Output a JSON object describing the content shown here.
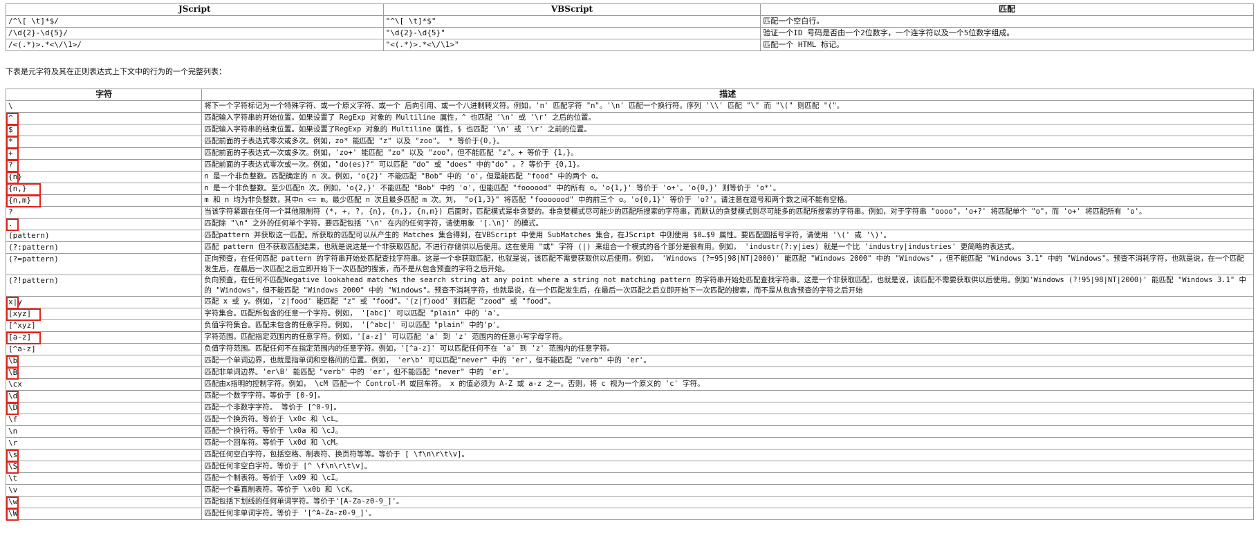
{
  "top_table": {
    "headers": [
      "JScript",
      "VBScript",
      "匹配"
    ],
    "rows": [
      [
        "/^\\[ \\t]*$/",
        "\"^\\[ \\t]*$\"",
        "匹配一个空白行。"
      ],
      [
        "/\\d{2}-\\d{5}/",
        "\"\\d{2}-\\d{5}\"",
        "验证一个ID 号码是否由一个2位数字，一个连字符以及一个5位数字组成。"
      ],
      [
        "/<(.*)>.*<\\/\\1>/",
        "\"<(.*)>.*<\\/\\1>\"",
        "匹配一个 HTML 标记。"
      ]
    ]
  },
  "intro_text": "下表是元字符及其在正则表达式上下文中的行为的一个完整列表：",
  "meta_table": {
    "headers": [
      "字符",
      "描述"
    ],
    "rows": [
      [
        "\\",
        "将下一个字符标记为一个特殊字符、或一个原义字符、或一个 后向引用、或一个八进制转义符。例如，'n' 匹配字符 \"n\"。'\\n' 匹配一个换行符。序列 '\\\\' 匹配 \"\\\" 而 \"\\(\" 则匹配 \"(\"。"
      ],
      [
        "^",
        "匹配输入字符串的开始位置。如果设置了 RegExp 对象的 Multiline 属性，^ 也匹配 '\\n' 或 '\\r' 之后的位置。"
      ],
      [
        "$",
        "匹配输入字符串的结束位置。如果设置了RegExp 对象的 Multiline 属性，$ 也匹配 '\\n' 或 '\\r' 之前的位置。"
      ],
      [
        "*",
        "匹配前面的子表达式零次或多次。例如，zo* 能匹配 \"z\" 以及 \"zoo\"。 * 等价于{0,}。"
      ],
      [
        "+",
        "匹配前面的子表达式一次或多次。例如，'zo+' 能匹配 \"zo\" 以及 \"zoo\"，但不能匹配 \"z\"。+ 等价于 {1,}。"
      ],
      [
        "?",
        "匹配前面的子表达式零次或一次。例如，\"do(es)?\" 可以匹配 \"do\" 或 \"does\" 中的\"do\" 。? 等价于 {0,1}。"
      ],
      [
        "{n}",
        "n 是一个非负整数。匹配确定的 n 次。例如，'o{2}' 不能匹配 \"Bob\" 中的 'o'，但是能匹配 \"food\" 中的两个 o。"
      ],
      [
        "{n,}",
        "n 是一个非负整数。至少匹配n 次。例如，'o{2,}' 不能匹配 \"Bob\" 中的 'o'，但能匹配 \"foooood\" 中的所有 o。'o{1,}' 等价于 'o+'。'o{0,}' 则等价于 'o*'。"
      ],
      [
        "{n,m}",
        "m 和 n 均为非负整数，其中n <= m。最少匹配 n 次且最多匹配 m 次。刘， \"o{1,3}\" 将匹配 \"fooooood\" 中的前三个 o。'o{0,1}' 等价于 'o?'。请注意在逗号和两个数之间不能有空格。"
      ],
      [
        "?",
        "当该字符紧跟在任何一个其他限制符 (*, +, ?, {n}, {n,}, {n,m}) 后面时，匹配模式是非贪婪的。非贪婪模式尽可能少的匹配所搜索的字符串，而默认的贪婪模式则尽可能多的匹配所搜索的字符串。例如，对于字符串 \"oooo\"，'o+?' 将匹配单个 \"o\"，而 'o+' 将匹配所有 'o'。"
      ],
      [
        ".",
        "匹配除 \"\\n\" 之外的任何单个字符。要匹配包括 '\\n' 在内的任何字符，请使用象 '[.\\n]' 的模式。"
      ],
      [
        "(pattern)",
        "匹配pattern 并获取这一匹配。所获取的匹配可以从产生的 Matches 集合得到，在VBScript 中使用 SubMatches 集合，在JScript 中则使用 $0…$9 属性。要匹配圆括号字符，请使用 '\\(' 或 '\\)'。"
      ],
      [
        "(?:pattern)",
        "匹配 pattern 但不获取匹配结果，也就是说这是一个非获取匹配，不进行存储供以后使用。这在使用 \"或\" 字符 (|) 来组合一个模式的各个部分是很有用。例如， 'industr(?:y|ies) 就是一个比 'industry|industries' 更简略的表达式。"
      ],
      [
        "(?=pattern)",
        "正向预查，在任何匹配 pattern 的字符串开始处匹配查找字符串。这是一个非获取匹配，也就是说，该匹配不需要获取供以后使用。例如， 'Windows (?=95|98|NT|2000)' 能匹配 \"Windows 2000\" 中的 \"Windows\" ，但不能匹配 \"Windows 3.1\" 中的 \"Windows\"。预查不消耗字符，也就是说，在一个匹配发生后，在最后一次匹配之后立即开始下一次匹配的搜索，而不是从包含预查的字符之后开始。"
      ],
      [
        "(?!pattern)",
        "负向预查，在任何不匹配Negative lookahead matches the search string at any point where a string not matching pattern 的字符串开始处匹配查找字符串。这是一个非获取匹配，也就是说，该匹配不需要获取供以后使用。例如'Windows (?!95|98|NT|2000)' 能匹配 \"Windows 3.1\" 中的 \"Windows\"，但不能匹配 \"Windows 2000\" 中的 \"Windows\"。预查不消耗字符，也就是说，在一个匹配发生后，在最后一次匹配之后立即开始下一次匹配的搜索，而不是从包含预查的字符之后开始"
      ],
      [
        "x|y",
        "匹配 x 或 y。例如，'z|food' 能匹配 \"z\" 或 \"food\"。'(z|f)ood' 则匹配 \"zood\" 或 \"food\"。"
      ],
      [
        "[xyz]",
        "字符集合。匹配所包含的任意一个字符。例如， '[abc]' 可以匹配 \"plain\" 中的 'a'。"
      ],
      [
        "[^xyz]",
        "负值字符集合。匹配未包含的任意字符。例如， '[^abc]' 可以匹配 \"plain\" 中的'p'。"
      ],
      [
        "[a-z]",
        "字符范围。匹配指定范围内的任意字符。例如，'[a-z]' 可以匹配 'a' 到 'z' 范围内的任意小写字母字符。"
      ],
      [
        "[^a-z]",
        "负值字符范围。匹配任何不在指定范围内的任意字符。例如，'[^a-z]' 可以匹配任何不在 'a' 到 'z' 范围内的任意字符。"
      ],
      [
        "\\b",
        "匹配一个单词边界，也就是指单词和空格间的位置。例如， 'er\\b' 可以匹配\"never\" 中的 'er'，但不能匹配 \"verb\" 中的 'er'。"
      ],
      [
        "\\B",
        "匹配非单词边界。'er\\B' 能匹配 \"verb\" 中的 'er'，但不能匹配 \"never\" 中的 'er'。"
      ],
      [
        "\\cx",
        "匹配由x指明的控制字符。例如， \\cM 匹配一个 Control-M 或回车符。 x 的值必须为 A-Z 或 a-z 之一。否则，将 c 视为一个原义的 'c' 字符。"
      ],
      [
        "\\d",
        "匹配一个数字字符。等价于 [0-9]。"
      ],
      [
        "\\D",
        "匹配一个非数字字符。 等价于 [^0-9]。"
      ],
      [
        "\\f",
        "匹配一个换页符。等价于 \\x0c 和 \\cL。"
      ],
      [
        "\\n",
        "匹配一个换行符。等价于 \\x0a 和 \\cJ。"
      ],
      [
        "\\r",
        "匹配一个回车符。等价于 \\x0d 和 \\cM。"
      ],
      [
        "\\s",
        "匹配任何空白字符，包括空格、制表符、换页符等等。等价于 [ \\f\\n\\r\\t\\v]。"
      ],
      [
        "\\S",
        "匹配任何非空白字符。等价于 [^ \\f\\n\\r\\t\\v]。"
      ],
      [
        "\\t",
        "匹配一个制表符。等价于 \\x09 和 \\cI。"
      ],
      [
        "\\v",
        "匹配一个垂直制表符。等价于 \\x0b 和 \\cK。"
      ],
      [
        "\\w",
        "匹配包括下划线的任何单词字符。等价于'[A-Za-z0-9_]'。"
      ],
      [
        "\\W",
        "匹配任何非单词字符。等价于 '[^A-Za-z0-9_]'。"
      ]
    ]
  },
  "accent_color": "#e0231b"
}
